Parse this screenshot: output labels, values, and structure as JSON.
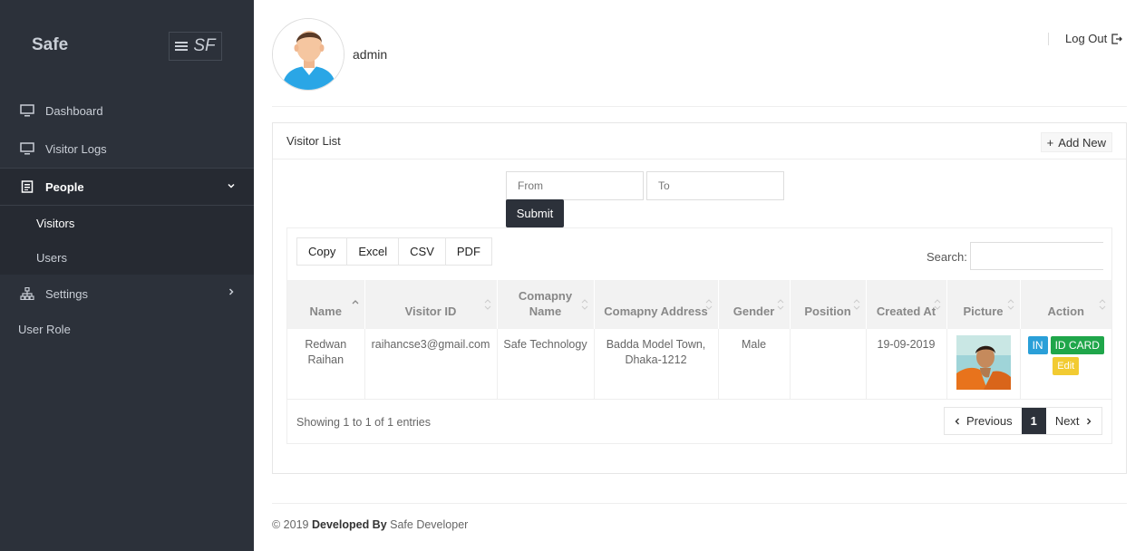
{
  "sidebar": {
    "brand": "Safe",
    "toggle_text": "SF",
    "items": [
      {
        "label": "Dashboard",
        "icon": "monitor-icon"
      },
      {
        "label": "Visitor Logs",
        "icon": "monitor-icon"
      },
      {
        "label": "People",
        "icon": "document-icon"
      },
      {
        "label": "Settings",
        "icon": "sitemap-icon"
      }
    ],
    "sub_items": [
      "Visitors",
      "Users"
    ],
    "role_label": "User Role"
  },
  "header": {
    "username": "admin",
    "logout_label": "Log Out"
  },
  "card": {
    "title": "Visitor List",
    "add_new_label": "Add New"
  },
  "filter": {
    "from_placeholder": "From",
    "to_placeholder": "To",
    "submit_label": "Submit"
  },
  "table_tools": {
    "buttons": [
      "Copy",
      "Excel",
      "CSV",
      "PDF"
    ],
    "search_label": "Search:"
  },
  "table": {
    "headers": [
      "Name",
      "Visitor ID",
      "Comapny Name",
      "Comapny Address",
      "Gender",
      "Position",
      "Created At",
      "Picture",
      "Action"
    ],
    "rows": [
      {
        "name": "Redwan Raihan",
        "visitor_id": "raihancse3@gmail.com",
        "company_name": "Safe Technology",
        "company_address": "Badda Model Town, Dhaka-1212",
        "gender": "Male",
        "position": "",
        "created_at": "19-09-2019",
        "actions": {
          "in": "IN",
          "id_card": "ID CARD",
          "edit": "Edit"
        }
      }
    ]
  },
  "pagination": {
    "info": "Showing 1 to 1 of 1 entries",
    "previous": "Previous",
    "current": "1",
    "next": "Next"
  },
  "footer": {
    "prefix": "© 2019",
    "developed_by": "Developed By",
    "developer": "Safe Developer"
  },
  "colors": {
    "sidebar_bg": "#2c313a",
    "in_badge": "#2a9fd8",
    "id_badge": "#1fa64a",
    "edit_badge": "#f2cb32"
  }
}
